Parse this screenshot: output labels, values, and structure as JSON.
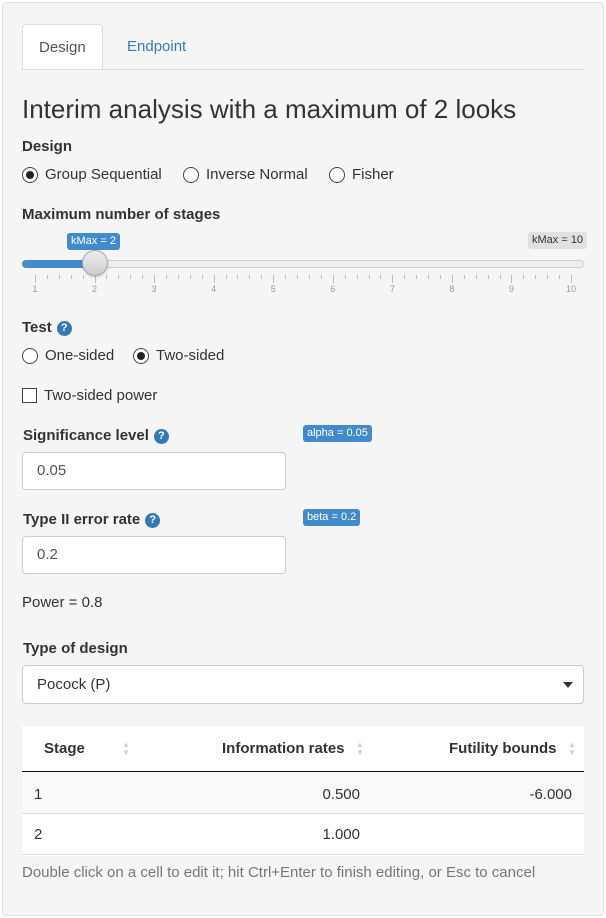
{
  "tabs": [
    {
      "label": "Design",
      "active": true
    },
    {
      "label": "Endpoint",
      "active": false
    }
  ],
  "heading": "Interim analysis with a maximum of 2 looks",
  "design": {
    "label": "Design",
    "options": [
      "Group Sequential",
      "Inverse Normal",
      "Fisher"
    ],
    "selected": "Group Sequential"
  },
  "stages": {
    "label": "Maximum number of stages",
    "value_badge": "kMax = 2",
    "max_badge": "kMax = 10",
    "value": 2,
    "min": 1,
    "max": 10,
    "tick_labels": [
      "1",
      "2",
      "3",
      "4",
      "5",
      "6",
      "7",
      "8",
      "9",
      "10"
    ]
  },
  "test": {
    "label": "Test",
    "help_icon": "question-circle-icon",
    "options": [
      "One-sided",
      "Two-sided"
    ],
    "selected": "Two-sided"
  },
  "two_sided_power": {
    "label": "Two-sided power",
    "checked": false
  },
  "significance": {
    "label": "Significance level",
    "badge": "alpha = 0.05",
    "value": "0.05"
  },
  "type2": {
    "label": "Type II error rate",
    "badge": "beta = 0.2",
    "value": "0.2"
  },
  "power_text": "Power = 0.8",
  "type_of_design": {
    "label": "Type of design",
    "selected": "Pocock (P)"
  },
  "table": {
    "headers": [
      "Stage",
      "Information rates",
      "Futility bounds"
    ],
    "rows": [
      [
        "1",
        "0.500",
        "-6.000"
      ],
      [
        "2",
        "1.000",
        ""
      ]
    ],
    "note": "Double click on a cell to edit it; hit Ctrl+Enter to finish editing, or Esc to cancel"
  },
  "colors": {
    "accent": "#428bca",
    "link": "#337ab7",
    "panel_bg": "#f5f5f5"
  }
}
